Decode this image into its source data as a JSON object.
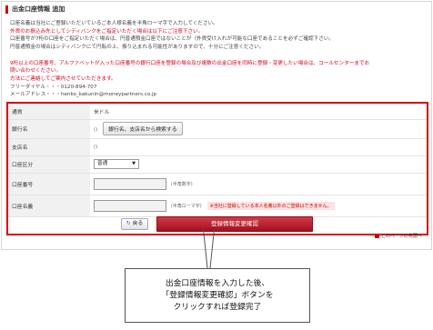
{
  "page": {
    "title": "出金口座情報 追加"
  },
  "notice": {
    "lines": [
      {
        "text": "口座名義は当社にご登録いただいているご本人様名義を半角ローマ字で入力してください。",
        "color": "normal"
      },
      {
        "text": "外貨のお振込み先としてシティバンクをご指定いただく場合は以下にご注意下さい。",
        "color": "red"
      },
      {
        "text": "口座番号が7桁の口座をご指定いただく場合は、円普通預金口座ではないことが（外貨受け入れが可能な口座であることを必ずご確認下さい。",
        "color": "normal"
      },
      {
        "text": "円普通預金の場合はシティバンクにて円転の上、振り込まれる可能性がありますので、十分にご注意ください。",
        "color": "normal"
      },
      {
        "text": "",
        "color": "normal"
      },
      {
        "text": "9桁以上の口座番号、アルファベットが入った口座番号の銀行口座を登録の場合及び複数の出金口座を同時に登録・変更したい場合は、コールセンターまでお",
        "color": "red"
      },
      {
        "text": "問い合わせください。",
        "color": "red"
      },
      {
        "text": "方法にご連絡してご案内させていただきます。",
        "color": "red"
      },
      {
        "text": "フリーダイヤル・・・0120-894-707",
        "color": "normal"
      },
      {
        "text": "メールアドレス・・・henko_kakunin@moneypartners.co.jp",
        "color": "normal"
      }
    ]
  },
  "form": {
    "rows": [
      {
        "label": "通貨",
        "value": "米ドル"
      },
      {
        "label": "銀行名",
        "paren": "()",
        "button": "銀行名、支店名から検索する"
      },
      {
        "label": "支店名",
        "paren": "()"
      },
      {
        "label": "口座区分",
        "select_value": "普通",
        "select_arrow": "▼"
      },
      {
        "label": "口座番号",
        "hint": "(半角数字)"
      },
      {
        "label": "口座名義",
        "hint": "(半角ローマ字)",
        "warning": "※当社に登録している本人名義以外のご登録はできません。"
      }
    ]
  },
  "actions": {
    "back_icon": "↻",
    "back_label": "戻る",
    "confirm_label": "登録情報変更確認"
  },
  "top_link": {
    "label": "このページの先頭へ"
  },
  "callout": {
    "lines": [
      "出金口座情報を入力した後、",
      "「登録情報変更確認」ボタンを",
      "クリックすれば登録完了"
    ]
  }
}
